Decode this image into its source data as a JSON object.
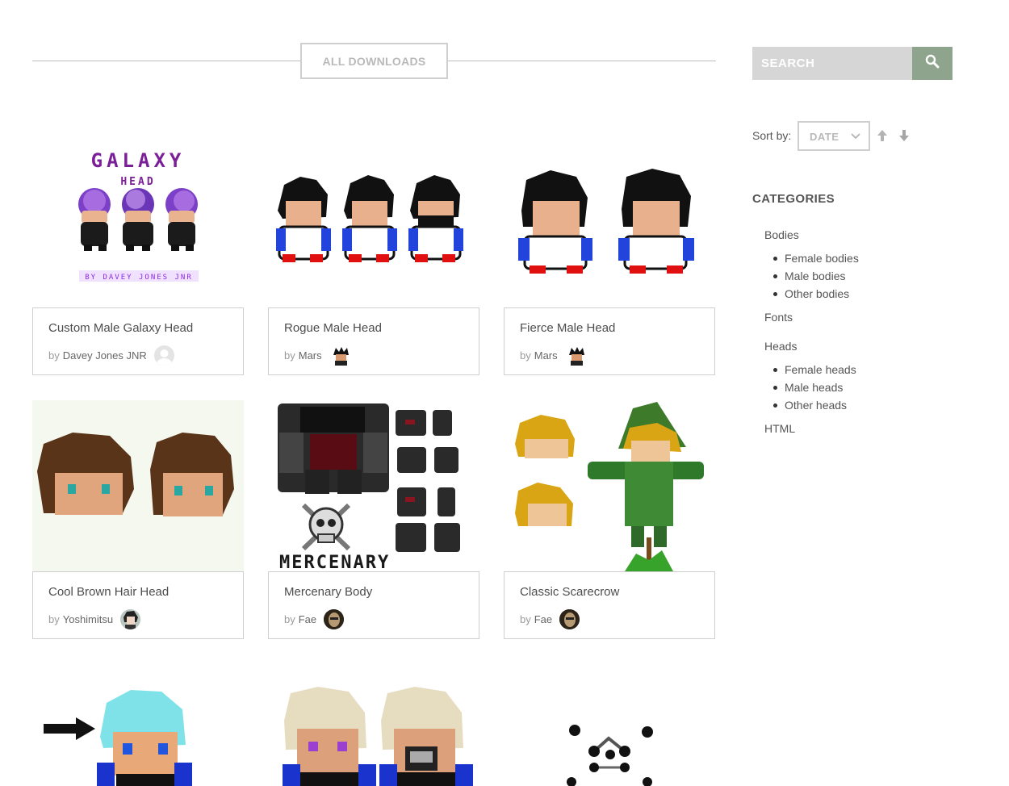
{
  "header": {
    "all_downloads_label": "ALL DOWNLOADS"
  },
  "search": {
    "placeholder": "SEARCH"
  },
  "sort": {
    "label": "Sort by:",
    "selected": "DATE"
  },
  "categories": {
    "title": "CATEGORIES",
    "bodies": "Bodies",
    "bodies_sub": [
      "Female bodies",
      "Male bodies",
      "Other bodies"
    ],
    "fonts": "Fonts",
    "heads": "Heads",
    "heads_sub": [
      "Female heads",
      "Male heads",
      "Other heads"
    ],
    "html": "HTML"
  },
  "items": [
    {
      "title": "Custom Male Galaxy Head",
      "by": "by",
      "author": "Davey Jones JNR",
      "thumb_text": [
        "GALAXY",
        "HEAD",
        "BY DAVEY JONES JNR"
      ]
    },
    {
      "title": "Rogue Male Head",
      "by": "by",
      "author": "Mars"
    },
    {
      "title": "Fierce Male Head",
      "by": "by",
      "author": "Mars"
    },
    {
      "title": "Cool Brown Hair Head",
      "by": "by",
      "author": "Yoshimitsu"
    },
    {
      "title": "Mercenary Body",
      "by": "by",
      "author": "Fae",
      "thumb_text": [
        "MERCENARY"
      ]
    },
    {
      "title": "Classic Scarecrow",
      "by": "by",
      "author": "Fae"
    }
  ],
  "colors": {
    "accent": "#8ea48d",
    "border": "#cfcfcf",
    "search_bg": "#d6d6d6"
  },
  "icons": [
    "search-icon",
    "chevron-down-icon",
    "arrow-up-icon",
    "arrow-down-icon"
  ]
}
